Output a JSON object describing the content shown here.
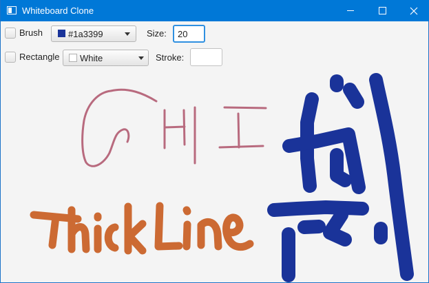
{
  "window": {
    "title": "Whiteboard Clone"
  },
  "toolbar": {
    "brush": {
      "label": "Brush",
      "checked": false,
      "color_label": "#1a3399",
      "color_value": "#1a3399"
    },
    "size": {
      "label": "Size:",
      "value": "20"
    },
    "rectangle": {
      "label": "Rectangle",
      "checked": false,
      "color_label": "White",
      "color_value": "#ffffff"
    },
    "stroke": {
      "label": "Stroke:",
      "value": ""
    }
  },
  "canvas": {
    "background": "#f4f4f4",
    "stroke_colors": {
      "pink": "#b86a7e",
      "orange": "#cc6a33",
      "blue": "#1a3399"
    }
  }
}
